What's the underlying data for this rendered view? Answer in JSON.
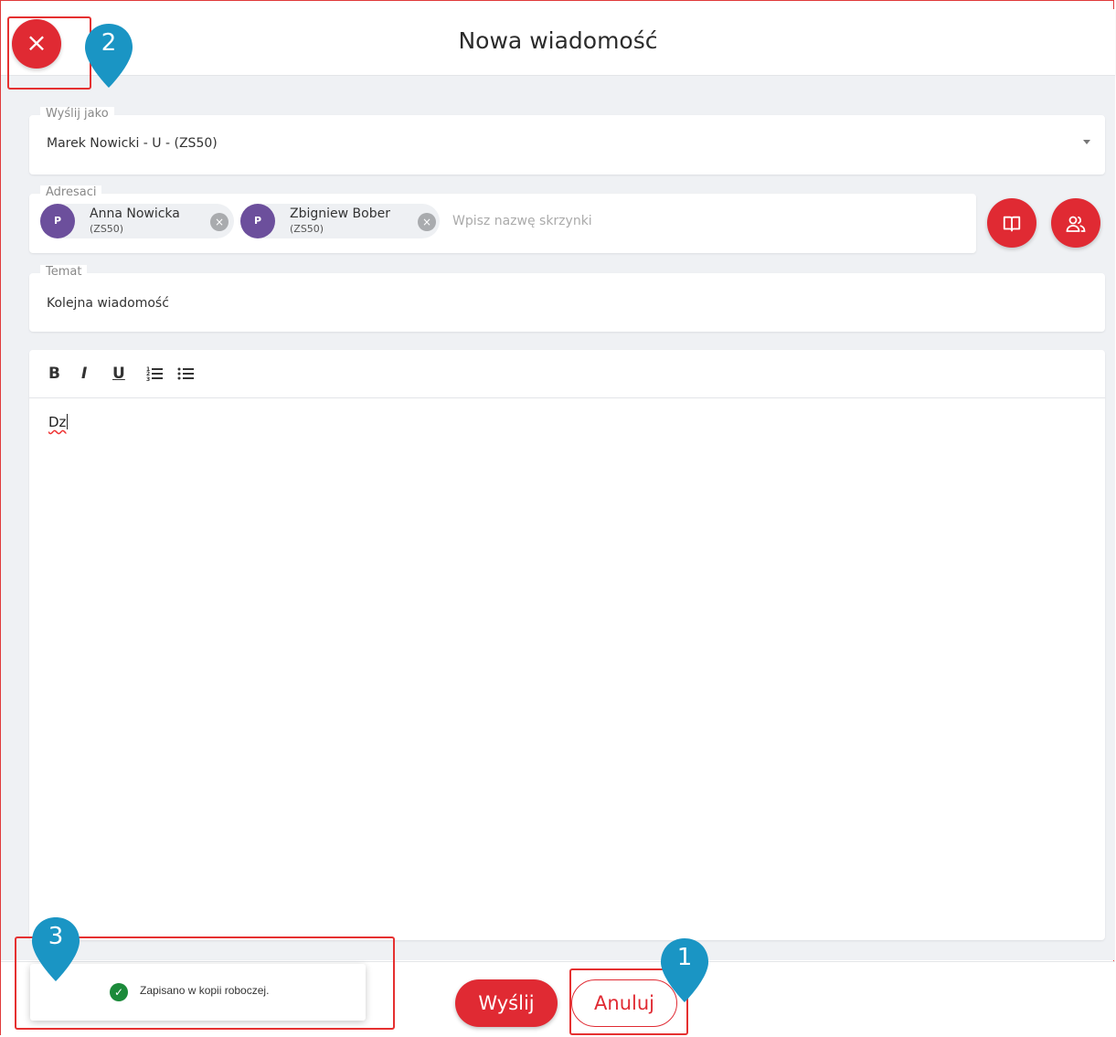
{
  "header": {
    "title": "Nowa wiadomość",
    "close_icon": "×"
  },
  "sender": {
    "legend": "Wyślij jako",
    "value": "Marek Nowicki - U - (ZS50)"
  },
  "recipients": {
    "legend": "Adresaci",
    "chips": [
      {
        "avatar": "P",
        "name": "Anna Nowicka",
        "sub": "(ZS50)"
      },
      {
        "avatar": "P",
        "name": "Zbigniew Bober",
        "sub": "(ZS50)"
      }
    ],
    "remove_icon": "×",
    "input_placeholder": "Wpisz nazwę skrzynki",
    "address_book_icon": "address-book-icon",
    "groups_icon": "user-group-icon"
  },
  "subject": {
    "legend": "Temat",
    "value": "Kolejna wiadomość"
  },
  "editor": {
    "toolbar": {
      "bold": "B",
      "italic": "I",
      "underline": "U",
      "ordered_list": "ordered-list-icon",
      "bullet_list": "bullet-list-icon"
    },
    "text": "Dz"
  },
  "footer": {
    "send_label": "Wyślij",
    "cancel_label": "Anuluj"
  },
  "toast": {
    "icon": "✓",
    "text": "Zapisano w kopii roboczej."
  },
  "annotations": {
    "pin1": "1",
    "pin2": "2",
    "pin3": "3"
  },
  "colors": {
    "accent": "#e02a33",
    "avatar": "#6c4f9c",
    "success": "#1b8a3a",
    "pin": "#1a95c4",
    "annotation_box": "#e53030"
  }
}
